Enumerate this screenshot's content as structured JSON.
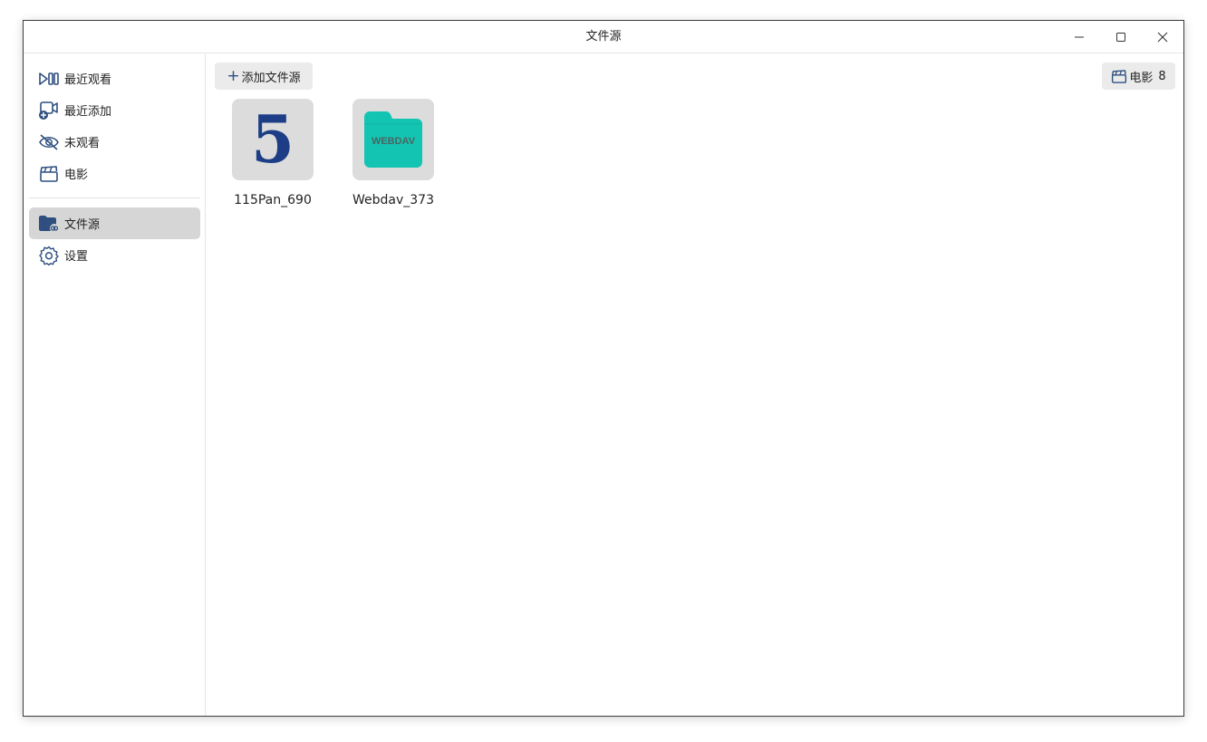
{
  "window": {
    "title": "文件源"
  },
  "sidebar": {
    "items": [
      {
        "label": "最近观看",
        "icon": "play-pause-icon",
        "active": false
      },
      {
        "label": "最近添加",
        "icon": "add-video-icon",
        "active": false
      },
      {
        "label": "未观看",
        "icon": "eye-off-icon",
        "active": false
      },
      {
        "label": "电影",
        "icon": "clapperboard-icon",
        "active": false
      },
      {
        "label": "文件源",
        "icon": "folder-link-icon",
        "active": true
      },
      {
        "label": "设置",
        "icon": "gear-icon",
        "active": false
      }
    ]
  },
  "toolbar": {
    "add_label": "添加文件源",
    "movie_label": "电影",
    "movie_count": "8"
  },
  "sources": [
    {
      "name": "115Pan_690",
      "icon": "115pan-logo",
      "logo_text": "5"
    },
    {
      "name": "Webdav_373",
      "icon": "webdav-folder-icon",
      "logo_text": "WEBDAV"
    }
  ],
  "colors": {
    "accent": "#2e4f7f",
    "webdav_folder": "#13c4b3",
    "pan_logo": "#1d3e86",
    "active_bg": "#d6d6d6"
  }
}
